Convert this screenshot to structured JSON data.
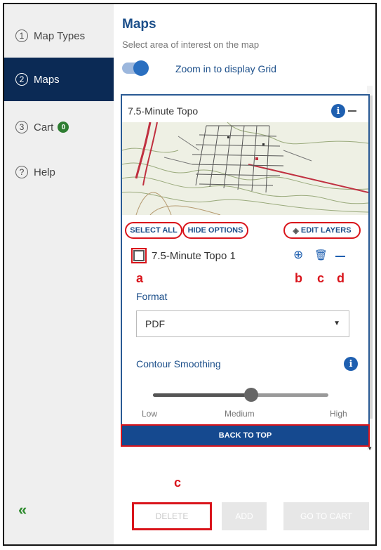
{
  "sidebar": {
    "items": [
      {
        "num": "1",
        "label": "Map Types"
      },
      {
        "num": "2",
        "label": "Maps"
      },
      {
        "num": "3",
        "label": "Cart",
        "badge": "0"
      },
      {
        "num": "?",
        "label": "Help"
      }
    ],
    "collapse_icon": "double-chevron-left-icon",
    "collapse_glyph": "«"
  },
  "main": {
    "title": "Maps",
    "subtitle": "Select area of interest on the map",
    "zoom_toggle": {
      "label": "Zoom in to display Grid",
      "on": true
    }
  },
  "card": {
    "title": "7.5-Minute Topo",
    "select_all": "SELECT ALL",
    "hide_options": "HIDE OPTIONS",
    "edit_layers": "EDIT LAYERS",
    "item": {
      "label": "7.5-Minute Topo 1",
      "checked": false
    },
    "format": {
      "label": "Format",
      "value": "PDF"
    },
    "contour": {
      "label": "Contour Smoothing",
      "ticks": [
        "Low",
        "Medium",
        "High"
      ],
      "value_fraction": 0.56
    },
    "back_to_top": "BACK TO TOP"
  },
  "annotations": {
    "a": "a",
    "b": "b",
    "c": "c",
    "d": "d",
    "c_footer": "c"
  },
  "footer": {
    "delete": "DELETE",
    "add": "ADD",
    "go_to_cart": "GO TO CART"
  },
  "colors": {
    "accent": "#1c4f8a",
    "active_nav": "#0b2a55",
    "highlight": "#d9141b",
    "badge": "#2e7d32"
  },
  "icons": {
    "info": "info-icon",
    "collapse": "minus-icon",
    "zoom": "zoom-in-icon",
    "delete": "trash-icon",
    "layers": "layers-icon",
    "dropdown": "chevron-down-icon"
  }
}
